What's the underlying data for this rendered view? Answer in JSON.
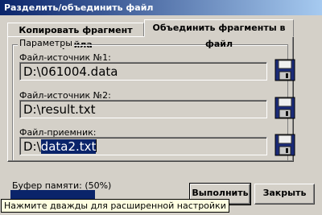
{
  "window": {
    "title": "Разделить/объединить файл"
  },
  "tabs": [
    {
      "label": "Копировать фрагмент файла",
      "active": false
    },
    {
      "label": "Объединить фрагменты в файл",
      "active": true
    }
  ],
  "params_group": {
    "label": "Параметры",
    "fields": [
      {
        "label": "Файл-источник №1:",
        "value": "D:\\061004.data"
      },
      {
        "label": "Файл-источник №2:",
        "value": "D:\\result.txt"
      },
      {
        "label": "Файл-приемник:",
        "value_prefix": "D:\\",
        "value_selected": "data2.txt"
      }
    ]
  },
  "buffer": {
    "label": "Буфер памяти: (50%)",
    "percent": 50,
    "color": "#0a246a"
  },
  "buttons": {
    "run": "Выполнить",
    "close": "Закрыть"
  },
  "tooltip": "Нажмите дважды для расширенной настройки",
  "icons": {
    "save": "floppy-disk-icon"
  }
}
